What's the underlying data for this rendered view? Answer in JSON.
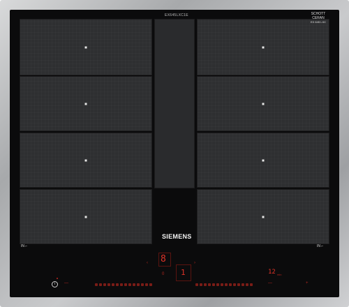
{
  "appliance": {
    "model_label": "EX645LXC1E",
    "brand": "SIEMENS",
    "badge_line1": "SCHOTT",
    "badge_line2": "CERAN",
    "badge_line3": "EX 645 LXC"
  },
  "zones": {
    "left_in_label": "IN",
    "right_in_label": "IN"
  },
  "controls": {
    "display_main": "8",
    "display_secondary": "1",
    "timer_display": "12",
    "timer_unit": "min",
    "zero_label": "0"
  },
  "colors": {
    "glass": "#0b0b0c",
    "zone": "#2e2f31",
    "display_red": "#e03328"
  }
}
